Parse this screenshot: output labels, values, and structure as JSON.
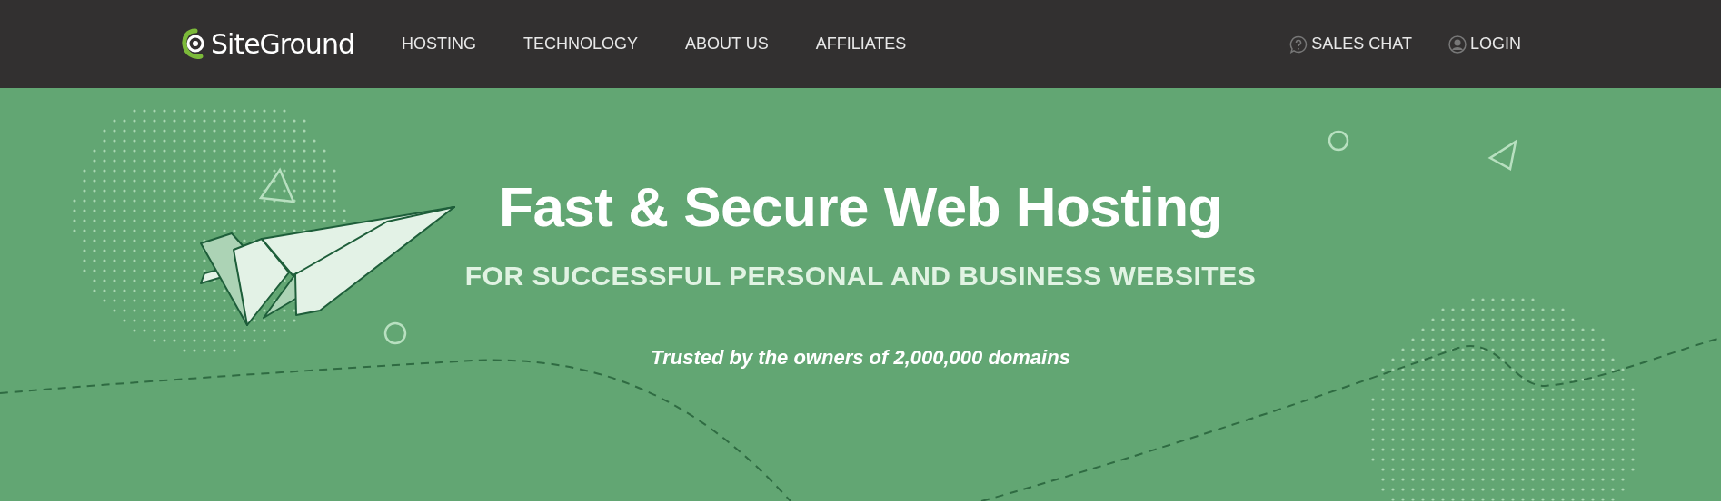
{
  "header": {
    "logo": "SiteGround",
    "nav": [
      {
        "label": "HOSTING"
      },
      {
        "label": "TECHNOLOGY"
      },
      {
        "label": "ABOUT US"
      },
      {
        "label": "AFFILIATES"
      }
    ],
    "actions": [
      {
        "kind": "chat",
        "label": "SALES CHAT"
      },
      {
        "kind": "login",
        "label": "LOGIN"
      }
    ]
  },
  "hero": {
    "title": "Fast & Secure Web Hosting",
    "subtitle": "FOR SUCCESSFUL PERSONAL AND BUSINESS WEBSITES",
    "tagline": "Trusted by the owners of 2,000,000 domains"
  }
}
